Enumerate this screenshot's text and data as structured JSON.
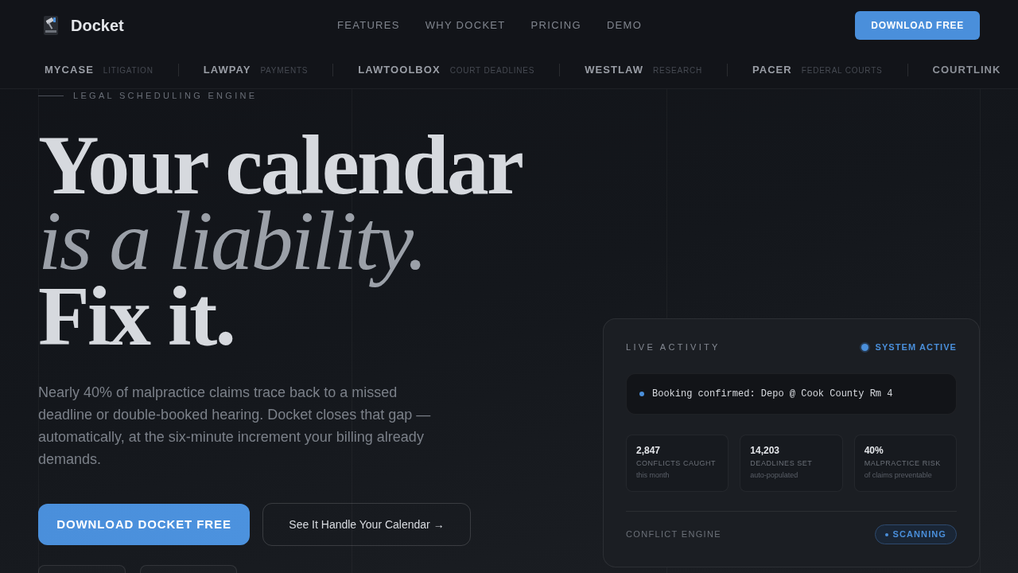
{
  "brand": {
    "name": "Docket"
  },
  "nav": {
    "links": [
      "FEATURES",
      "WHY DOCKET",
      "PRICING",
      "DEMO"
    ],
    "cta": "DOWNLOAD FREE"
  },
  "partners": [
    {
      "name": "MYCASE",
      "category": "LITIGATION"
    },
    {
      "name": "LAWPAY",
      "category": "PAYMENTS"
    },
    {
      "name": "LAWTOOLBOX",
      "category": "COURT DEADLINES"
    },
    {
      "name": "WESTLAW",
      "category": "RESEARCH"
    },
    {
      "name": "PACER",
      "category": "FEDERAL COURTS"
    },
    {
      "name": "COURTLINK"
    }
  ],
  "hero": {
    "eyebrow": "LEGAL SCHEDULING ENGINE",
    "headline": [
      {
        "text": "Your calendar",
        "kind": "roman"
      },
      {
        "text": "is a liability.",
        "kind": "italic"
      },
      {
        "text": "Fix it.",
        "kind": "roman"
      }
    ],
    "body": "Nearly 40% of malpractice claims trace back to a missed deadline or double-booked hearing. Docket closes that gap — automatically, at the six-minute increment your billing already demands.",
    "buttons": [
      {
        "label": "DOWNLOAD DOCKET FREE",
        "kind": "primary"
      },
      {
        "label": "See It Handle Your Calendar →",
        "kind": "secondary"
      }
    ]
  },
  "activity_card": {
    "title": "LIVE ACTIVITY",
    "status": "SYSTEM ACTIVE",
    "event": "Booking confirmed: Depo @ Cook County Rm 4",
    "stats": [
      {
        "value": "2,847",
        "label": "CONFLICTS CAUGHT",
        "note": "this month"
      },
      {
        "value": "14,203",
        "label": "DEADLINES SET",
        "note": "auto-populated"
      },
      {
        "value": "40%",
        "label": "MALPRACTICE RISK",
        "note": "of claims preventable"
      }
    ],
    "engine": {
      "label": "CONFLICT ENGINE",
      "status": "SCANNING"
    }
  }
}
